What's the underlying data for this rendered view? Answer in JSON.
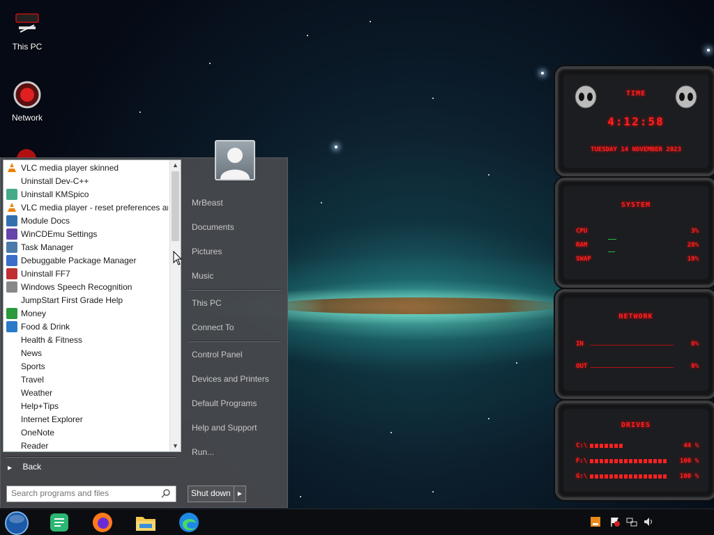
{
  "desktop": {
    "icons": [
      {
        "label": "This PC"
      },
      {
        "label": "Network"
      }
    ]
  },
  "start_menu": {
    "programs": [
      {
        "label": "VLC media player skinned",
        "icon": "vlc-icon"
      },
      {
        "label": "Uninstall Dev-C++",
        "icon": "blank-icon"
      },
      {
        "label": "Uninstall KMSpico",
        "icon": "kmspico-icon"
      },
      {
        "label": "VLC media player - reset preferences and cache files",
        "icon": "vlc-icon"
      },
      {
        "label": "Module Docs",
        "icon": "python-icon"
      },
      {
        "label": "WinCDEmu Settings",
        "icon": "wincdemu-icon"
      },
      {
        "label": "Task Manager",
        "icon": "task-manager-icon"
      },
      {
        "label": "Debuggable Package Manager",
        "icon": "package-icon"
      },
      {
        "label": "Uninstall FF7",
        "icon": "uninstall-icon"
      },
      {
        "label": "Windows Speech Recognition",
        "icon": "microphone-icon"
      },
      {
        "label": "JumpStart First Grade Help",
        "icon": "blank-icon"
      },
      {
        "label": "Money",
        "icon": "money-icon"
      },
      {
        "label": "Food & Drink",
        "icon": "food-icon"
      },
      {
        "label": "Health & Fitness",
        "icon": "blank-icon"
      },
      {
        "label": "News",
        "icon": "blank-icon"
      },
      {
        "label": "Sports",
        "icon": "blank-icon"
      },
      {
        "label": "Travel",
        "icon": "blank-icon"
      },
      {
        "label": "Weather",
        "icon": "blank-icon"
      },
      {
        "label": "Help+Tips",
        "icon": "blank-icon"
      },
      {
        "label": "Internet Explorer",
        "icon": "blank-icon"
      },
      {
        "label": "OneNote",
        "icon": "blank-icon"
      },
      {
        "label": "Reader",
        "icon": "blank-icon"
      }
    ],
    "back_label": "Back",
    "search_placeholder": "Search programs and files",
    "right_items": {
      "user": "MrBeast",
      "documents": "Documents",
      "pictures": "Pictures",
      "music": "Music",
      "this_pc": "This PC",
      "connect_to": "Connect To",
      "control_panel": "Control Panel",
      "devices_printers": "Devices and Printers",
      "default_programs": "Default Programs",
      "help_support": "Help and Support",
      "run": "Run..."
    },
    "shutdown_label": "Shut down"
  },
  "gadgets": {
    "time": {
      "title": "TIME",
      "clock": "4:12:58",
      "date": "TUESDAY 14 NOVEMBER 2023"
    },
    "system": {
      "title": "SYSTEM",
      "rows": [
        {
          "label": "CPU",
          "value": "3%"
        },
        {
          "label": "RAM",
          "value": "28%"
        },
        {
          "label": "SWAP",
          "value": "19%"
        }
      ]
    },
    "network": {
      "title": "NETWORK",
      "rows": [
        {
          "label": "IN",
          "value": "0%"
        },
        {
          "label": "OUT",
          "value": "0%"
        }
      ]
    },
    "drives": {
      "title": "DRIVES",
      "rows": [
        {
          "label": "C:\\",
          "value": "44 %",
          "fill": 0.44
        },
        {
          "label": "F:\\",
          "value": "100 %",
          "fill": 1.0
        },
        {
          "label": "G:\\",
          "value": "100 %",
          "fill": 1.0
        }
      ]
    },
    "accent_color": "#ff2020"
  },
  "taskbar": {
    "pinned": [
      "start-orb-icon",
      "notepad-icon",
      "firefox-icon",
      "file-explorer-icon",
      "edge-icon"
    ],
    "tray": [
      "java-icon",
      "action-center-flag-icon",
      "network-tray-icon",
      "volume-icon"
    ]
  }
}
